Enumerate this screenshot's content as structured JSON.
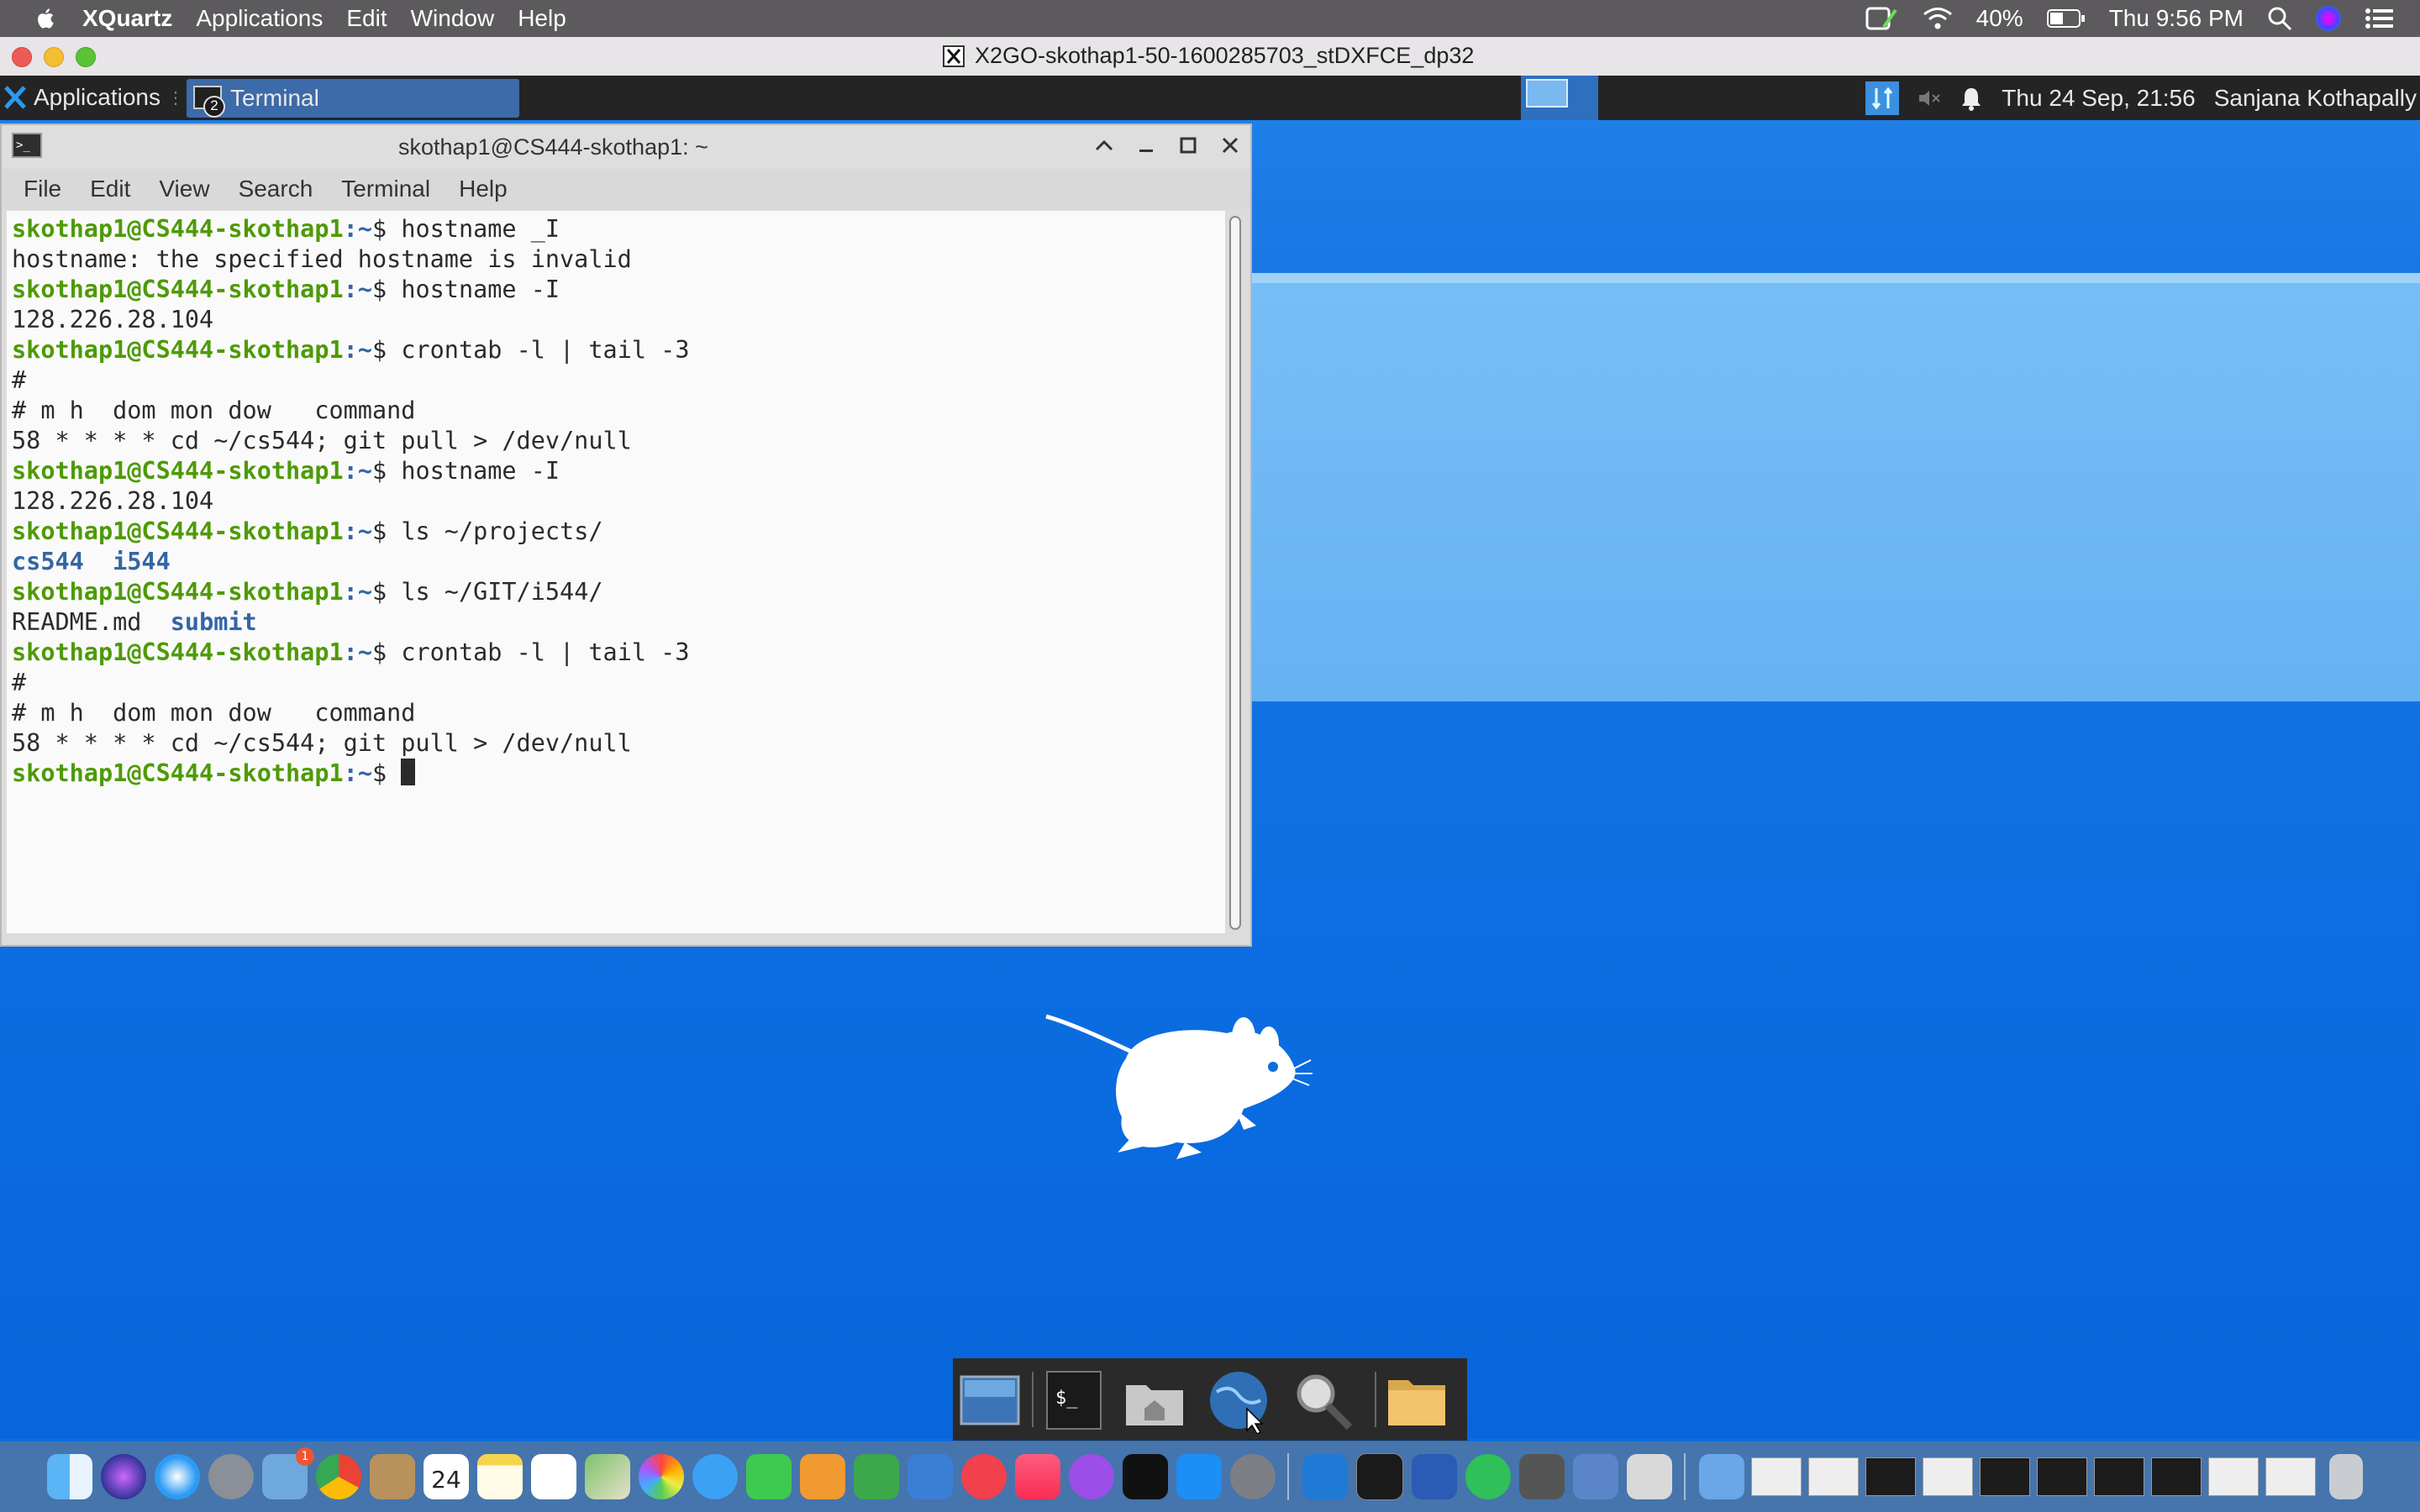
{
  "mac_menubar": {
    "app_name": "XQuartz",
    "menus": [
      "Applications",
      "Edit",
      "Window",
      "Help"
    ],
    "battery": "40%",
    "clock": "Thu 9:56 PM"
  },
  "xquartz_window": {
    "title": "X2GO-skothap1-50-1600285703_stDXFCE_dp32"
  },
  "xfce_panel": {
    "applications_label": "Applications",
    "task_label": "Terminal",
    "task_badge": "2",
    "datetime": "Thu 24 Sep, 21:56",
    "user": "Sanjana Kothapally"
  },
  "terminal": {
    "title": "skothap1@CS444-skothap1: ~",
    "menus": [
      "File",
      "Edit",
      "View",
      "Search",
      "Terminal",
      "Help"
    ],
    "prompt": "skothap1@CS444-skothap1",
    "prompt_suffix": ":~$ ",
    "lines": [
      {
        "type": "cmd",
        "text": "hostname _I"
      },
      {
        "type": "out",
        "text": "hostname: the specified hostname is invalid"
      },
      {
        "type": "cmd",
        "text": "hostname -I"
      },
      {
        "type": "out",
        "text": "128.226.28.104"
      },
      {
        "type": "cmd",
        "text": "crontab -l | tail -3"
      },
      {
        "type": "out",
        "text": "#"
      },
      {
        "type": "out",
        "text": "# m h  dom mon dow   command"
      },
      {
        "type": "out",
        "text": "58 * * * * cd ~/cs544; git pull > /dev/null"
      },
      {
        "type": "cmd",
        "text": "hostname -I"
      },
      {
        "type": "out",
        "text": "128.226.28.104"
      },
      {
        "type": "cmd",
        "text": "ls ~/projects/"
      },
      {
        "type": "dirs",
        "items": [
          "cs544",
          "i544"
        ]
      },
      {
        "type": "cmd",
        "text": "ls ~/GIT/i544/"
      },
      {
        "type": "mixed",
        "file": "README.md",
        "dir": "submit"
      },
      {
        "type": "cmd",
        "text": "crontab -l | tail -3"
      },
      {
        "type": "out",
        "text": "#"
      },
      {
        "type": "out",
        "text": "# m h  dom mon dow   command"
      },
      {
        "type": "out",
        "text": "58 * * * * cd ~/cs544; git pull > /dev/null"
      },
      {
        "type": "cursor"
      }
    ]
  },
  "mac_dock": {
    "calendar_day": "24",
    "mail_badge": "1"
  },
  "colors": {
    "prompt": "#4e9a06",
    "dir": "#3465a4",
    "desktop": "#0a6fe0",
    "panel": "#242424"
  }
}
